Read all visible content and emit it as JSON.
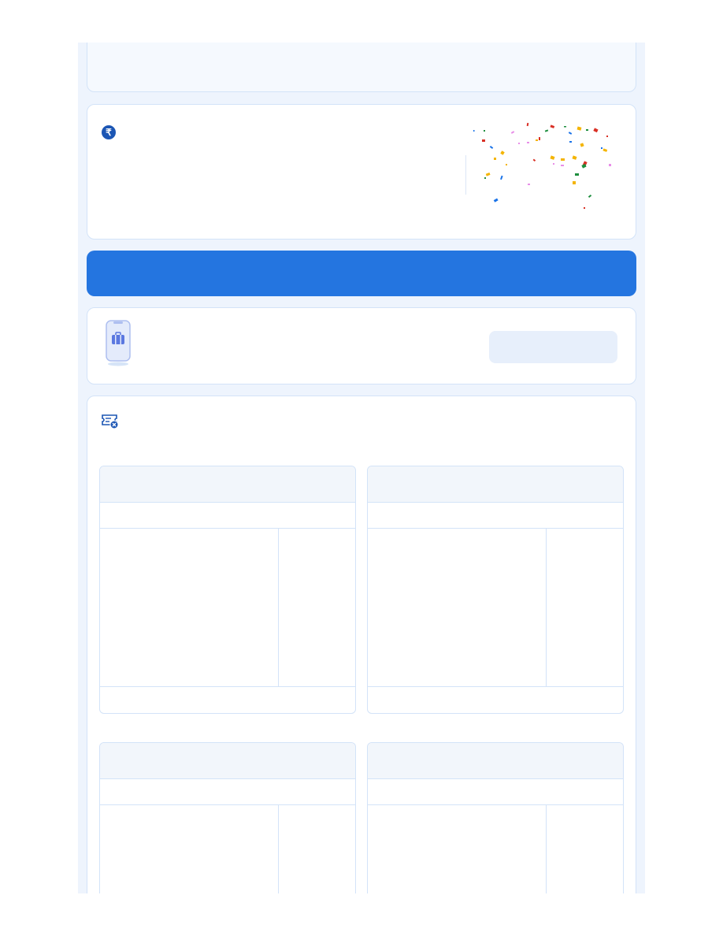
{
  "top_card": {},
  "refund_card": {
    "icon": "rupee-icon",
    "icon_glyph": "₹",
    "decoration": "confetti-illustration"
  },
  "banner": {
    "color": "#2475e0"
  },
  "app_card": {
    "icon": "phone-suitcase-icon",
    "button_label": ""
  },
  "cancellation_card": {
    "icon": "ticket-cancel-icon",
    "policies": [
      {
        "header": "",
        "subheader": "",
        "left_cell": "",
        "right_cell": "",
        "footer": ""
      },
      {
        "header": "",
        "subheader": "",
        "left_cell": "",
        "right_cell": "",
        "footer": ""
      },
      {
        "header": "",
        "subheader": "",
        "left_cell": "",
        "right_cell": "",
        "footer": ""
      },
      {
        "header": "",
        "subheader": "",
        "left_cell": "",
        "right_cell": "",
        "footer": ""
      }
    ]
  },
  "colors": {
    "page_background": "#eef4fd",
    "card_border": "#d3e3f8",
    "accent_blue": "#2475e0",
    "icon_blue": "#1c56b4"
  }
}
